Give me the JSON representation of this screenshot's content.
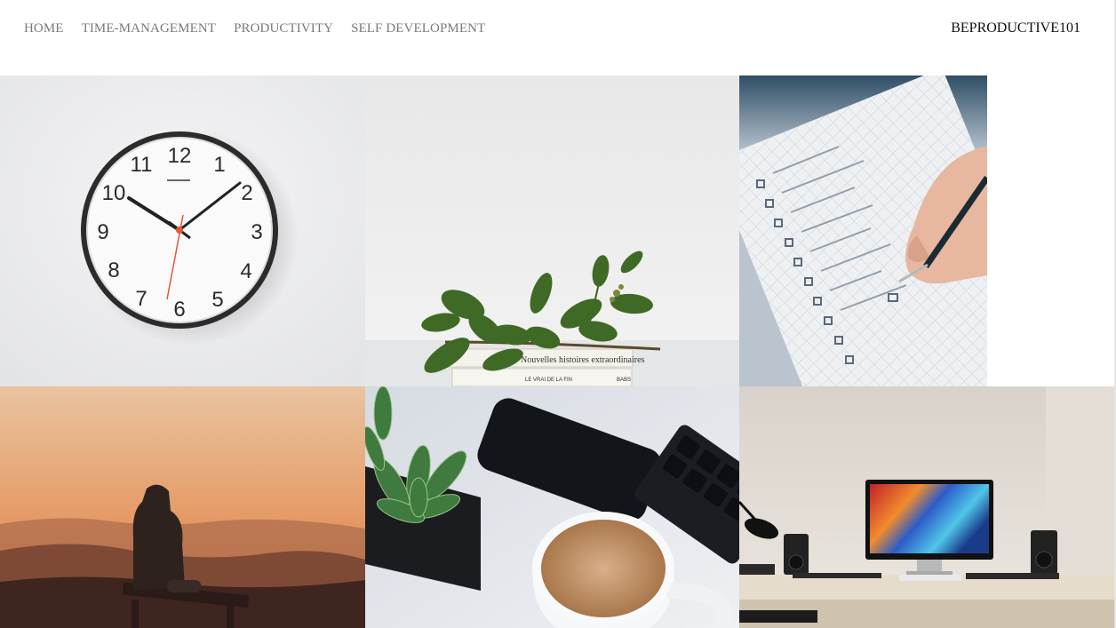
{
  "nav": {
    "links": [
      "HOME",
      "TIME-MANAGEMENT",
      "PRODUCTIVITY",
      "SELF DEVELOPMENT"
    ],
    "brand": "BEPRODUCTIVE101"
  },
  "gallery": {
    "tiles": [
      {
        "name": "wall-clock-photo",
        "clock_numbers": [
          "12",
          "1",
          "2",
          "3",
          "4",
          "5",
          "6",
          "7",
          "8",
          "9",
          "10",
          "11"
        ]
      },
      {
        "name": "plant-on-books-photo",
        "book_titles": [
          "Nouvelles histoires extraordinaires",
          "LE VRAI DE LA FIN",
          "BABS"
        ]
      },
      {
        "name": "checklist-writing-photo"
      },
      {
        "name": "sunset-mountain-photo"
      },
      {
        "name": "coffee-succulent-phone-photo"
      },
      {
        "name": "desk-computer-setup-photo"
      }
    ]
  }
}
